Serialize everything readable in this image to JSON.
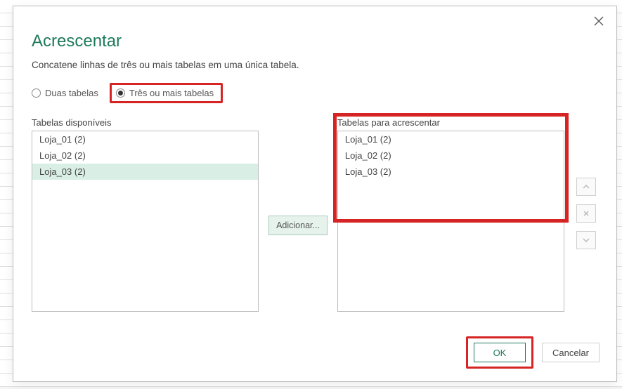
{
  "dialog": {
    "title": "Acrescentar",
    "description": "Concatene linhas de três ou mais tabelas em uma única tabela.",
    "radios": {
      "two": {
        "label": "Duas tabelas",
        "selected": false
      },
      "three": {
        "label": "Três ou mais tabelas",
        "selected": true
      }
    },
    "left": {
      "label": "Tabelas disponíveis",
      "items": [
        {
          "text": "Loja_01 (2)",
          "selected": false
        },
        {
          "text": "Loja_02 (2)",
          "selected": false
        },
        {
          "text": "Loja_03 (2)",
          "selected": true
        }
      ]
    },
    "add_label": "Adicionar...",
    "right": {
      "label": "Tabelas para acrescentar",
      "items": [
        {
          "text": "Loja_01 (2)"
        },
        {
          "text": "Loja_02 (2)"
        },
        {
          "text": "Loja_03 (2)"
        }
      ]
    },
    "ok_label": "OK",
    "cancel_label": "Cancelar"
  },
  "highlights": {
    "radio_three": true,
    "right_list": true,
    "ok_button": true
  },
  "colors": {
    "accent_green": "#1f7a5a",
    "annotation_red": "#d62424",
    "selected_row_bg": "#d9efe5"
  }
}
